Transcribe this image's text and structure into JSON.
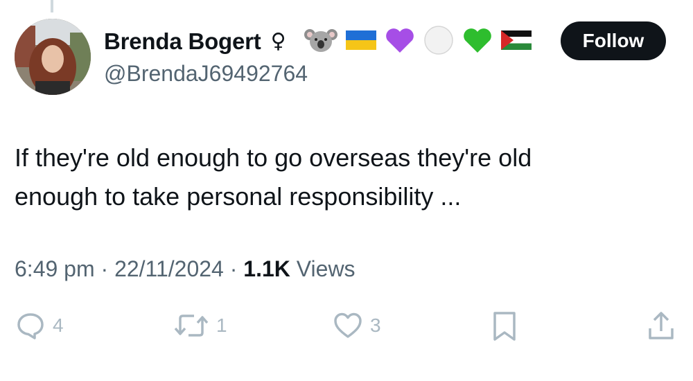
{
  "tweet": {
    "author": {
      "display_name": "Brenda Bogert",
      "gender_symbol": "♀",
      "handle": "@BrendaJ69492764",
      "emojis": [
        "koala-emoji",
        "ukraine-flag-emoji",
        "purple-heart-emoji",
        "white-circle-emoji",
        "green-heart-emoji",
        "palestine-flag-emoji"
      ]
    },
    "follow_label": "Follow",
    "text_line1": "If they're old enough to go overseas they're old",
    "text_line2": "enough to take personal responsibility ...",
    "time": "6:49 pm",
    "separator": "·",
    "date": "22/11/2024",
    "views_count": "1.1K",
    "views_label": "Views",
    "actions": {
      "reply_count": "4",
      "retweet_count": "1",
      "like_count": "3"
    }
  },
  "colors": {
    "text_primary": "#0f1419",
    "text_secondary": "#536471",
    "action_gray": "#aab8c2",
    "follow_bg": "#0f1419"
  }
}
